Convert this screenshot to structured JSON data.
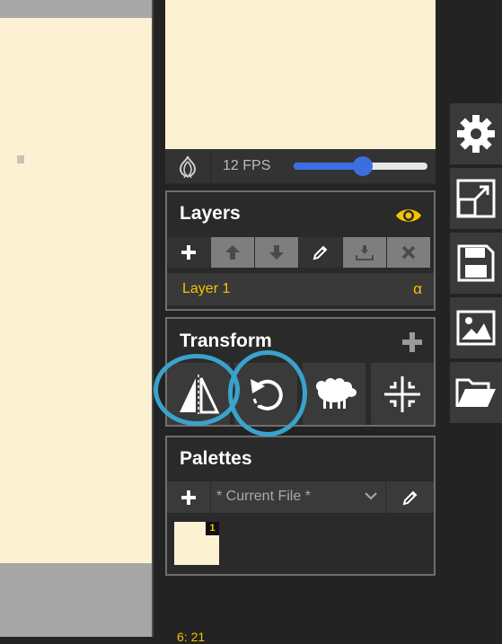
{
  "preview": {
    "fps_label": "12 FPS",
    "fps_slider_fraction": 0.52
  },
  "layers": {
    "title": "Layers",
    "toolbar": [
      {
        "name": "add-layer-button",
        "icon": "plus-icon",
        "state": "active"
      },
      {
        "name": "move-layer-up-button",
        "icon": "arrow-up-icon",
        "state": "disabled"
      },
      {
        "name": "move-layer-down-button",
        "icon": "arrow-down-icon",
        "state": "disabled"
      },
      {
        "name": "edit-layer-button",
        "icon": "pencil-icon",
        "state": "active"
      },
      {
        "name": "merge-layer-button",
        "icon": "merge-down-icon",
        "state": "disabled"
      },
      {
        "name": "delete-layer-button",
        "icon": "close-icon",
        "state": "disabled"
      }
    ],
    "items": [
      {
        "label": "Layer 1",
        "alpha": "α"
      }
    ]
  },
  "transform": {
    "title": "Transform"
  },
  "palettes": {
    "title": "Palettes",
    "selected": "* Current File *",
    "swatches": [
      {
        "color": "#fcf1d3",
        "badge": "1"
      }
    ]
  },
  "rail": [
    "settings-icon",
    "resize-icon",
    "save-icon",
    "image-icon",
    "folder-open-icon"
  ],
  "status": {
    "text": "6: 21"
  },
  "colors": {
    "accent": "#f5c400",
    "canvas": "#fcf1d3",
    "slider": "#3b6fe0",
    "annotation": "#3aa3cc"
  }
}
